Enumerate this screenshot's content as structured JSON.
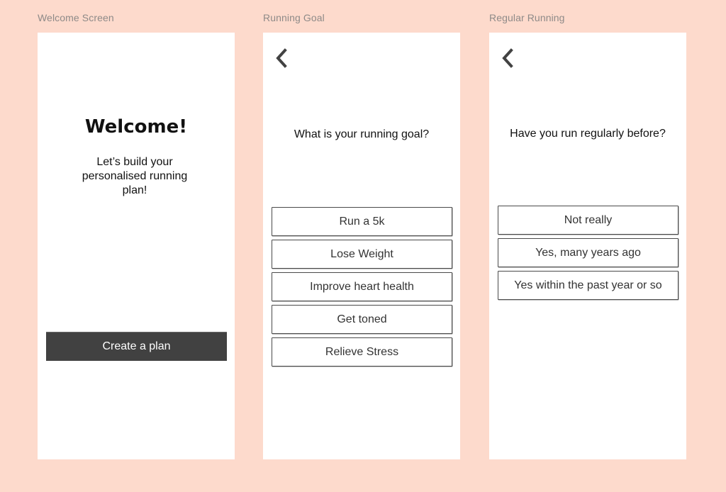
{
  "frames": {
    "welcome": {
      "label": "Welcome Screen",
      "title": "Welcome!",
      "subtitle": "Let’s build your personalised running plan!",
      "cta_label": "Create a plan"
    },
    "running_goal": {
      "label": "Running Goal",
      "back_icon": "chevron-left-icon",
      "question": "What is your running goal?",
      "options": [
        "Run a 5k",
        "Lose Weight",
        "Improve heart health",
        "Get toned",
        "Relieve Stress"
      ]
    },
    "regular_running": {
      "label": "Regular Running",
      "back_icon": "chevron-left-icon",
      "question": "Have you run regularly before?",
      "options": [
        "Not really",
        "Yes, many years ago",
        "Yes within the past year or so"
      ]
    }
  },
  "colors": {
    "canvas_bg": "#fddacc",
    "frame_bg": "#ffffff",
    "primary_button": "#414141",
    "label_text": "#8e8a88"
  }
}
